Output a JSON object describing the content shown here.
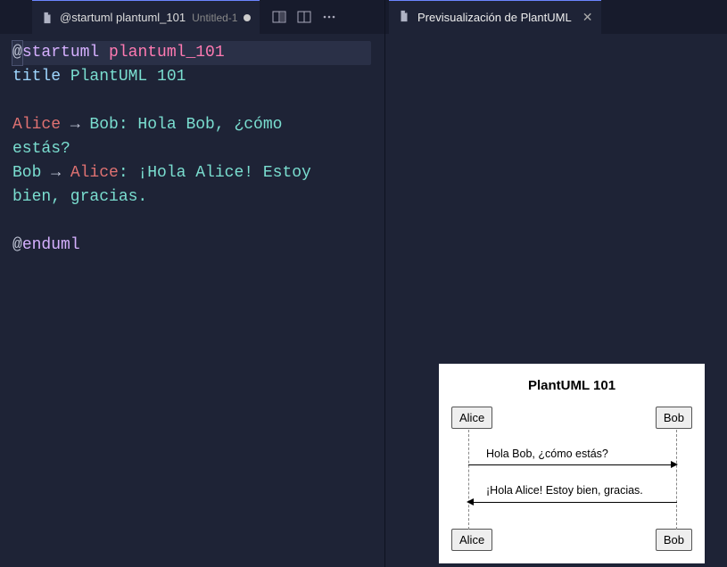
{
  "left": {
    "tab": {
      "title": "@startuml plantuml_101",
      "subtitle": "Untitled-1",
      "dirty": true
    }
  },
  "editor": {
    "l1_at": "@",
    "l1_tag": "startuml",
    "l1_name": " plantuml_101",
    "l2_kw": "title",
    "l2_val": " PlantUML 101",
    "l4_a": "Alice",
    "l4_arrow": " → ",
    "l4_b": "Bob",
    "l4_rest": ": Hola Bob, ¿cómo",
    "l5": "estás?",
    "l6_a": "Bob",
    "l6_arrow": " → ",
    "l6_b": "Alice",
    "l6_rest": ": ¡Hola Alice! Estoy",
    "l7": "bien, gracias.",
    "l9_at": "@",
    "l9_tag": "enduml"
  },
  "right": {
    "tab": {
      "title": "Previsualización de PlantUML"
    }
  },
  "diagram": {
    "title": "PlantUML 101",
    "actor_a": "Alice",
    "actor_b": "Bob",
    "msg1": "Hola Bob, ¿cómo estás?",
    "msg2": "¡Hola Alice! Estoy bien, gracias."
  }
}
